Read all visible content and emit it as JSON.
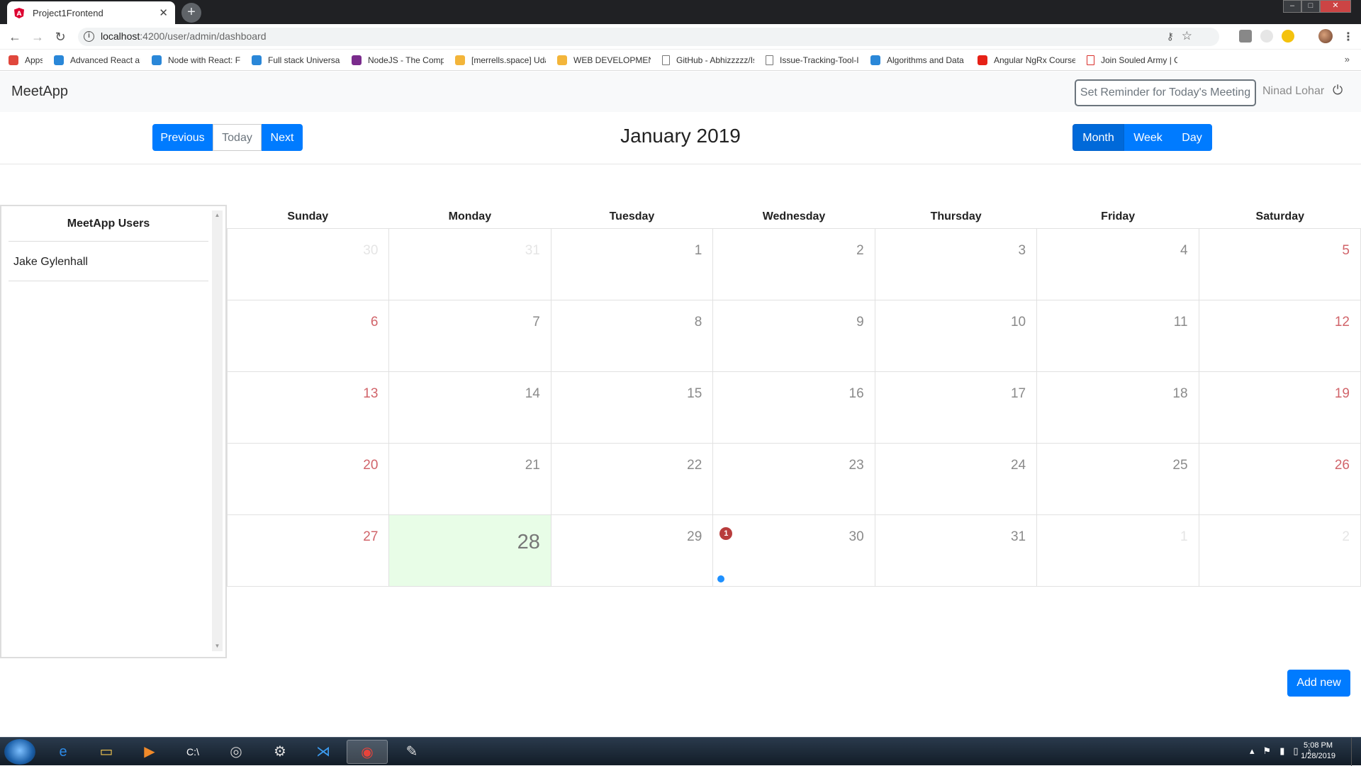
{
  "browser": {
    "tab_title": "Project1Frontend",
    "url_host": "localhost",
    "url_path": ":4200/user/admin/dashboard"
  },
  "bookmarks": [
    {
      "label": "Apps",
      "icon": "apps-grid-icon",
      "color": "#e0473c"
    },
    {
      "label": "Advanced React and",
      "icon": "sp-icon",
      "color": "#2a87d8"
    },
    {
      "label": "Node with React: Full",
      "icon": "sp-icon",
      "color": "#2a87d8"
    },
    {
      "label": "Full stack Universal R",
      "icon": "sp-icon",
      "color": "#2a87d8"
    },
    {
      "label": "NodeJS - The Comple",
      "icon": "ms-icon",
      "color": "#7a2b8c"
    },
    {
      "label": "[merrells.space] Udac",
      "icon": "drive-icon",
      "color": "#f3b53a"
    },
    {
      "label": "WEB DEVELOPMENT",
      "icon": "drive-icon",
      "color": "#f3b53a"
    },
    {
      "label": "GitHub - Abhizzzzz/Is",
      "icon": "page-icon",
      "color": "#777777"
    },
    {
      "label": "Issue-Tracking-Tool-I",
      "icon": "page-icon",
      "color": "#777777"
    },
    {
      "label": "Algorithms and Data",
      "icon": "sp-icon",
      "color": "#2a87d8"
    },
    {
      "label": "Angular NgRx Course",
      "icon": "youtube-icon",
      "color": "#e62117"
    },
    {
      "label": "Join Souled Army | C",
      "icon": "page-icon",
      "color": "#d9302c"
    }
  ],
  "app": {
    "brand": "MeetApp",
    "reminder_button": "Set Reminder for Today's Meeting",
    "username": "Ninad Lohar"
  },
  "calendar": {
    "title": "January 2019",
    "nav": {
      "previous": "Previous",
      "today": "Today",
      "next": "Next"
    },
    "views": {
      "month": "Month",
      "week": "Week",
      "day": "Day"
    },
    "weekdays": [
      "Sunday",
      "Monday",
      "Tuesday",
      "Wednesday",
      "Thursday",
      "Friday",
      "Saturday"
    ],
    "weeks": [
      [
        {
          "d": "30",
          "o": true
        },
        {
          "d": "31",
          "o": true
        },
        {
          "d": "1"
        },
        {
          "d": "2"
        },
        {
          "d": "3"
        },
        {
          "d": "4"
        },
        {
          "d": "5"
        }
      ],
      [
        {
          "d": "6"
        },
        {
          "d": "7"
        },
        {
          "d": "8"
        },
        {
          "d": "9"
        },
        {
          "d": "10"
        },
        {
          "d": "11"
        },
        {
          "d": "12"
        }
      ],
      [
        {
          "d": "13"
        },
        {
          "d": "14"
        },
        {
          "d": "15"
        },
        {
          "d": "16"
        },
        {
          "d": "17"
        },
        {
          "d": "18"
        },
        {
          "d": "19"
        }
      ],
      [
        {
          "d": "20"
        },
        {
          "d": "21"
        },
        {
          "d": "22"
        },
        {
          "d": "23"
        },
        {
          "d": "24"
        },
        {
          "d": "25"
        },
        {
          "d": "26"
        }
      ],
      [
        {
          "d": "27"
        },
        {
          "d": "28",
          "today": true
        },
        {
          "d": "29"
        },
        {
          "d": "30",
          "badge": "1",
          "event": true
        },
        {
          "d": "31"
        },
        {
          "d": "1",
          "o": true
        },
        {
          "d": "2",
          "o": true
        }
      ]
    ],
    "add_new": "Add new"
  },
  "users_panel": {
    "title": "MeetApp Users",
    "users": [
      "Jake Gylenhall"
    ]
  },
  "taskbar": {
    "time": "5:08 PM",
    "date": "1/28/2019"
  }
}
